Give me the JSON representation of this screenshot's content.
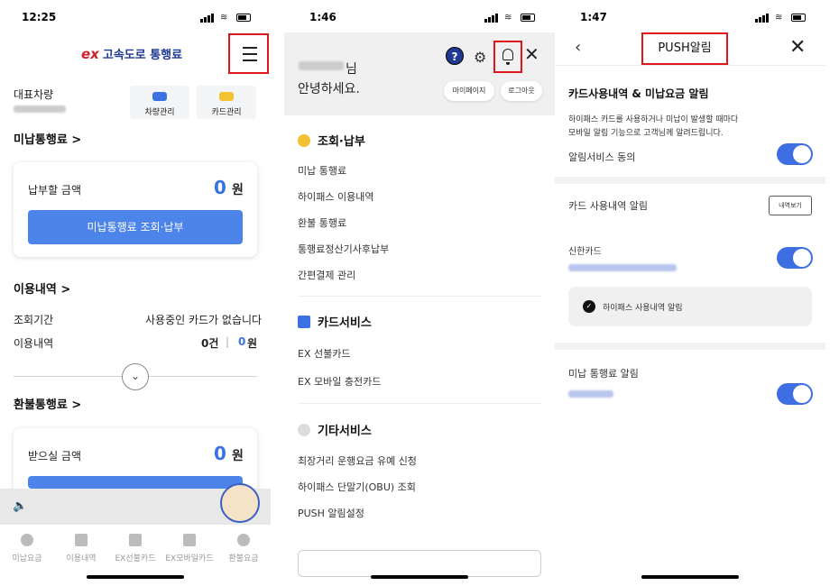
{
  "panel1": {
    "time": "12:25",
    "logo_ex": "ex",
    "logo_text": "고속도로 통행료",
    "rep_vehicle_label": "대표차량",
    "vehicle_button": "차량관리",
    "card_button": "카드관리",
    "unpaid_title": "미납통행료 >",
    "pay_amount_label": "납부할 금액",
    "pay_amount_value": "0",
    "won": "원",
    "unpaid_button": "미납통행료 조회·납부",
    "usage_title": "이용내역 >",
    "period_label": "조회기간",
    "period_value": "사용중인 카드가 없습니다",
    "usage_label": "이용내역",
    "usage_count": "0건",
    "usage_sep": "|",
    "usage_amount": "0",
    "usage_won": "원",
    "refund_title": "환불통행료 >",
    "receive_label": "받으실 금액",
    "receive_value": "0",
    "receive_won": "원",
    "tabs": [
      "미납요금",
      "이용내역",
      "EX선불카드",
      "EX모바일카드",
      "환불요금"
    ]
  },
  "panel2": {
    "time": "1:46",
    "greeting_suffix": "님",
    "greeting": "안녕하세요.",
    "help": "?",
    "mypage": "마이페이지",
    "logout": "로그아웃",
    "sec1": "조회·납부",
    "sec1_items": [
      "미납 통행료",
      "하이패스 이용내역",
      "환불 통행료",
      "통행료정산기사후납부",
      "간편결제 관리"
    ],
    "sec2": "카드서비스",
    "sec2_items": [
      "EX 선불카드",
      "EX 모바일 충전카드"
    ],
    "sec3": "기타서비스",
    "sec3_items": [
      "최장거리 운행요금 유예 신청",
      "하이패스 단말기(OBU) 조회",
      "PUSH 알림설정"
    ]
  },
  "panel3": {
    "time": "1:47",
    "title": "PUSH알림",
    "section_title": "카드사용내역 & 미납요금 알림",
    "desc1": "하이패스 카드를 사용하거나 미납이 발생할 때마다",
    "desc2": "모바일 알림 기능으로 고객님께 알려드립니다.",
    "consent": "알림서비스 동의",
    "card_alert": "카드 사용내역 알림",
    "detail_button": "내역보기",
    "card_name": "신한카드",
    "hipass_alert": "하이패스 사용내역 알림",
    "unpaid_alert": "미납 통행료 알림"
  },
  "colors": {
    "accent_blue": "#4d84ea",
    "toggle_blue": "#3d6fe2",
    "highlight_red": "#e0161e",
    "brand_navy": "#1f3a93"
  }
}
